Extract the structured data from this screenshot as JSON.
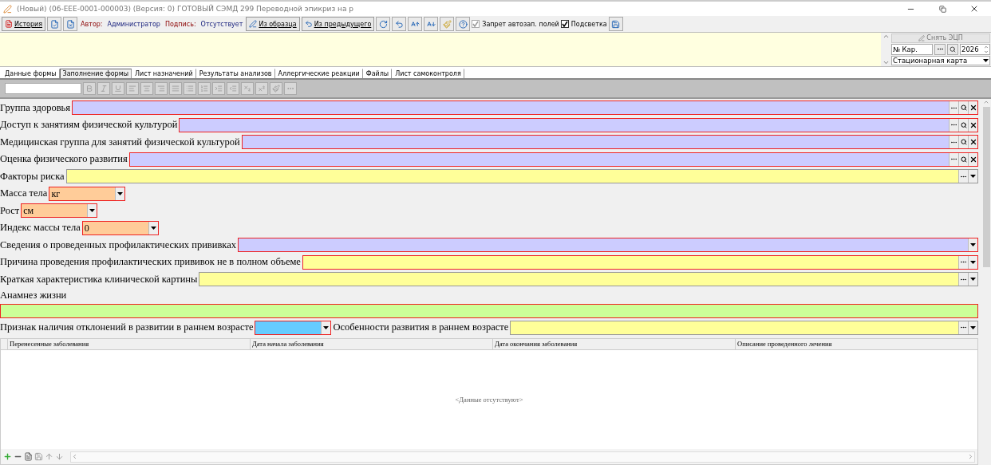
{
  "window": {
    "title": "(Новый) (06-EEE-0001-000003) (Версия: 0) ГОТОВЫЙ СЭМД 299 Переводной эпикриз на р"
  },
  "toolbar": {
    "history_button": "История",
    "author_label": "Автор:",
    "author": "Администратор",
    "signature_label": "Подпись:",
    "signature": "Отсутствует",
    "from_template_button": "Из образца",
    "from_previous_button": "Из предыдущего",
    "checkboxes": [
      {
        "label": "Запрет автозап. полей",
        "checked": true,
        "disabled": true
      },
      {
        "label": "Подсветка",
        "checked": true,
        "disabled": false
      }
    ]
  },
  "side_panel": {
    "remove_signature_button": "Снять ЭЦП",
    "card_number": "№ Кар.",
    "year": "2026",
    "card_type": "Стационарная карта"
  },
  "tabs": [
    {
      "label": "Данные формы",
      "selected": false
    },
    {
      "label": "Заполнение формы",
      "selected": true
    },
    {
      "label": "Лист назначений",
      "selected": false
    },
    {
      "label": "Результаты анализов",
      "selected": false
    },
    {
      "label": "Аллергические реакции",
      "selected": false
    },
    {
      "label": "Файлы",
      "selected": false
    },
    {
      "label": "Лист самоконтроля",
      "selected": false
    }
  ],
  "form_rows": [
    {
      "fields": [
        {
          "label": "Группа здоровья",
          "kind": "lookup",
          "color": "#ccccff",
          "required": true
        }
      ]
    },
    {
      "fields": [
        {
          "label": "Доступ к занятиям физической культурой",
          "kind": "lookup",
          "color": "#ccccff",
          "required": true
        }
      ]
    },
    {
      "fields": [
        {
          "label": "Медицинская группа для занятий физической культурой",
          "kind": "lookup",
          "color": "#ccccff",
          "required": true
        }
      ]
    },
    {
      "fields": [
        {
          "label": "Оценка физического развития",
          "kind": "lookup",
          "color": "#ccccff",
          "required": true
        }
      ]
    },
    {
      "fields": [
        {
          "label": "Факторы риска",
          "kind": "combo",
          "color": "#ffff99",
          "required": false
        }
      ]
    },
    {
      "fields": [
        {
          "label": "Масса тела",
          "kind": "short",
          "value": "кг",
          "color": "#ffcc99",
          "required": true
        }
      ]
    },
    {
      "fields": [
        {
          "label": "Рост",
          "kind": "short",
          "value": "см",
          "color": "#ffcc99",
          "required": true
        }
      ]
    },
    {
      "fields": [
        {
          "label": "Индекс массы тела",
          "kind": "short",
          "value": "0",
          "color": "#ffcc99",
          "required": true
        }
      ]
    },
    {
      "fields": [
        {
          "label": "Сведения о проведенных профилактических прививках",
          "kind": "select",
          "color": "#ccccff",
          "required": true
        }
      ]
    },
    {
      "fields": [
        {
          "label": "Причина проведения профилактических прививок не в полном объеме",
          "kind": "combo",
          "color": "#ffff99",
          "required": true
        }
      ]
    },
    {
      "fields": [
        {
          "label": "Краткая характеристика клинической картины",
          "kind": "combo",
          "color": "#ffff99",
          "required": false
        }
      ]
    },
    {
      "fields": [
        {
          "label": "Анамнез жизни",
          "kind": "memo",
          "color": "#ccff99",
          "required": true
        }
      ]
    },
    {
      "fields": [
        {
          "label": "Признак наличия отклонений в развитии в раннем возрасте",
          "kind": "short",
          "color": "#66ccff",
          "required": true
        },
        {
          "label": "Особенности развития в раннем возрасте",
          "kind": "combo",
          "color": "#ffff99",
          "required": false
        }
      ]
    }
  ],
  "table": {
    "columns": [
      "Перенесенные заболевания",
      "Дата начала заболевания",
      "Дата окончания заболевания",
      "Описание проведенного лечения"
    ],
    "empty_text": "<Данные отсутствуют>"
  }
}
